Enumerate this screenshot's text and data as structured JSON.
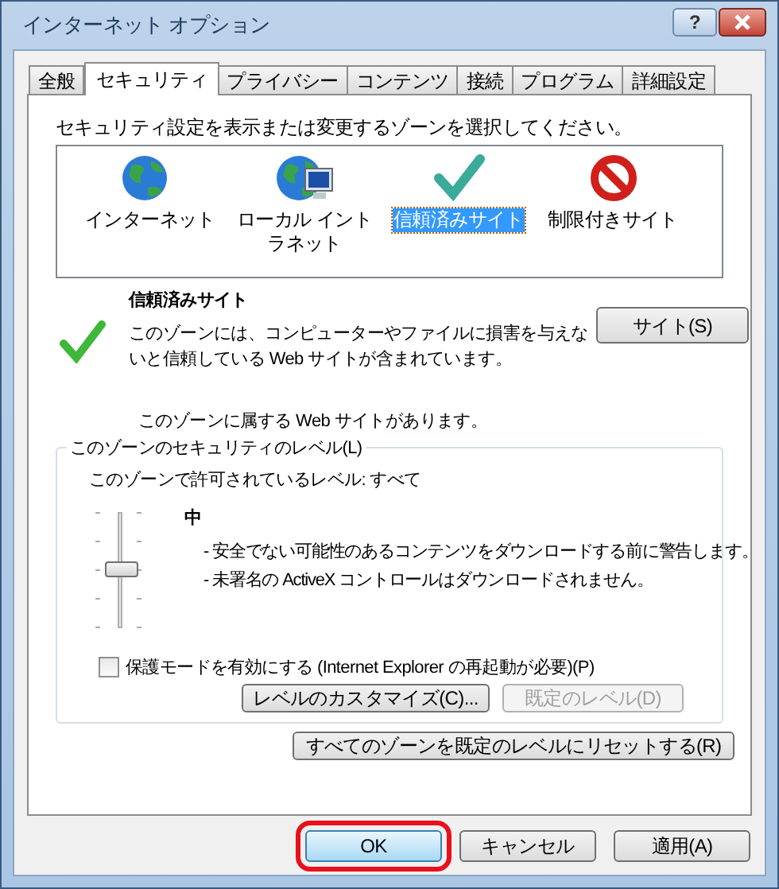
{
  "window": {
    "title": "インターネット オプション",
    "help": "?"
  },
  "tabs": [
    {
      "label": "全般",
      "selected": false
    },
    {
      "label": "セキュリティ",
      "selected": true
    },
    {
      "label": "プライバシー",
      "selected": false
    },
    {
      "label": "コンテンツ",
      "selected": false
    },
    {
      "label": "接続",
      "selected": false
    },
    {
      "label": "プログラム",
      "selected": false
    },
    {
      "label": "詳細設定",
      "selected": false
    }
  ],
  "zone_prompt": "セキュリティ設定を表示または変更するゾーンを選択してください。",
  "zones": [
    {
      "kind": "globe",
      "label": "インターネット",
      "selected": false
    },
    {
      "kind": "intranet",
      "label": "ローカル イントラネット",
      "selected": false
    },
    {
      "kind": "check",
      "label": "信頼済みサイト",
      "selected": true
    },
    {
      "kind": "blocked",
      "label": "制限付きサイト",
      "selected": false
    }
  ],
  "zone_info": {
    "title": "信頼済みサイト",
    "description": "このゾーンには、コンピューターやファイルに損害を与えないと信頼している Web サイトが含まれています。",
    "sites_button": "サイト(S)",
    "note": "このゾーンに属する Web サイトがあります。"
  },
  "security_level": {
    "legend": "このゾーンのセキュリティのレベル(L)",
    "allowed": "このゾーンで許可されているレベル: すべて",
    "level": 0.5,
    "level_name": "中",
    "bullets": [
      "- 安全でない可能性のあるコンテンツをダウンロードする前に警告します。",
      "- 未署名の ActiveX コントロールはダウンロードされません。"
    ],
    "protected_mode": {
      "label": "保護モードを有効にする (Internet Explorer の再起動が必要)(P)",
      "checked": false
    },
    "buttons": [
      {
        "label": "レベルのカスタマイズ(C)...",
        "disabled": false
      },
      {
        "label": "既定のレベル(D)",
        "disabled": true
      }
    ]
  },
  "reset_button": "すべてのゾーンを既定のレベルにリセットする(R)",
  "dialog_buttons": [
    {
      "label": "OK",
      "highlighted": true
    },
    {
      "label": "キャンセル",
      "highlighted": false
    },
    {
      "label": "適用(A)",
      "highlighted": false
    }
  ]
}
